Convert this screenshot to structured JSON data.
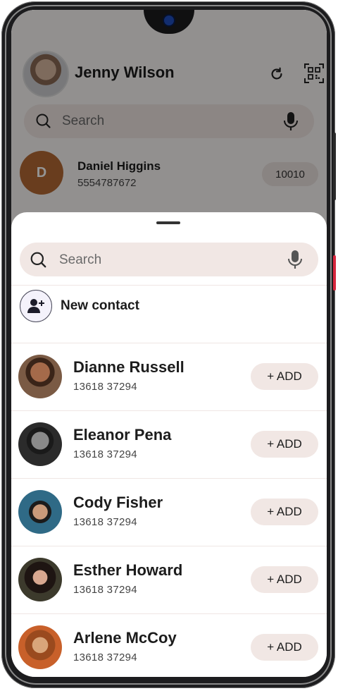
{
  "background_app": {
    "profile_name": "Jenny Wilson",
    "search_placeholder": "Search",
    "contact": {
      "initial": "D",
      "name": "Daniel Higgins",
      "phone": "5554787672",
      "badge": "10010"
    }
  },
  "sheet": {
    "search_placeholder": "Search",
    "new_contact_label": "New contact",
    "add_label": "+ ADD",
    "contacts": [
      {
        "name": "Dianne Russell",
        "phone": "13618 37294"
      },
      {
        "name": "Eleanor Pena",
        "phone": "13618 37294"
      },
      {
        "name": "Cody Fisher",
        "phone": "13618 37294"
      },
      {
        "name": "Esther Howard",
        "phone": "13618 37294"
      },
      {
        "name": "Arlene McCoy",
        "phone": "13618 37294"
      }
    ]
  },
  "colors": {
    "chip_background": "#f1e7e4",
    "initial_avatar": "#b56a35",
    "side_button_accent": "#d7263d"
  },
  "icons": {
    "refresh": "refresh-icon",
    "qr": "qr-code-icon",
    "search": "search-icon",
    "mic": "mic-icon",
    "add_contact": "add-person-icon"
  }
}
